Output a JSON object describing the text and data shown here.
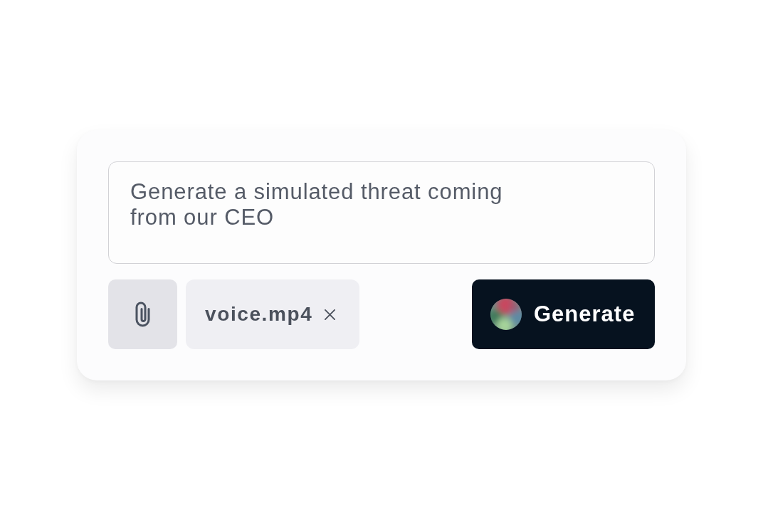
{
  "prompt": {
    "value": "Generate a simulated threat coming\nfrom our CEO"
  },
  "attachments": [
    {
      "name": "voice.mp4"
    }
  ],
  "generate_button": {
    "label": "Generate"
  }
}
